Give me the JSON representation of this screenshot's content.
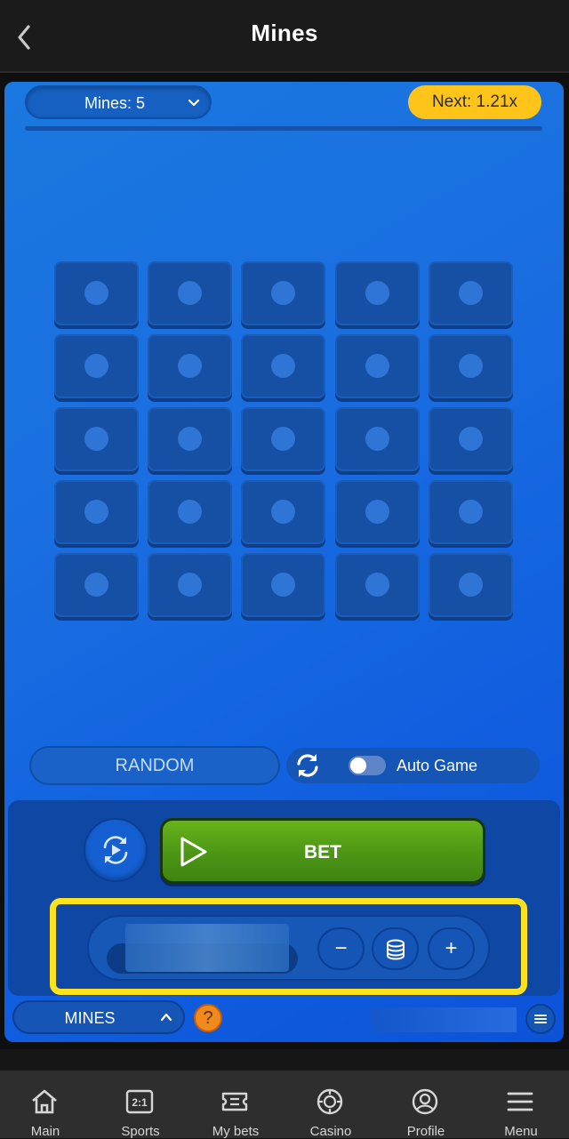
{
  "header": {
    "title": "Mines",
    "back_icon": "chevron-left-icon"
  },
  "game": {
    "mines_select": "Mines: 5",
    "next_multiplier": "Next: 1.21x",
    "grid": {
      "rows": 5,
      "cols": 5
    },
    "random_label": "RANDOM",
    "auto_game_label": "Auto Game",
    "auto_game_enabled": false,
    "bet_label": "BET",
    "stake_minus": "−",
    "stake_plus": "+",
    "stake_coins_icon": "coins-stack-icon",
    "mode_select": "MINES",
    "help_label": "?"
  },
  "colors": {
    "accent_yellow": "#ffc41a",
    "bet_green": "#4c9615",
    "panel_blue": "#0e47a4",
    "highlight": "#ffe21a"
  },
  "tabbar": [
    {
      "label": "Main",
      "icon": "home-icon"
    },
    {
      "label": "Sports",
      "icon": "sports-odds-icon"
    },
    {
      "label": "My bets",
      "icon": "ticket-icon"
    },
    {
      "label": "Casino",
      "icon": "casino-chip-icon"
    },
    {
      "label": "Profile",
      "icon": "profile-icon"
    },
    {
      "label": "Menu",
      "icon": "hamburger-menu-icon"
    }
  ]
}
